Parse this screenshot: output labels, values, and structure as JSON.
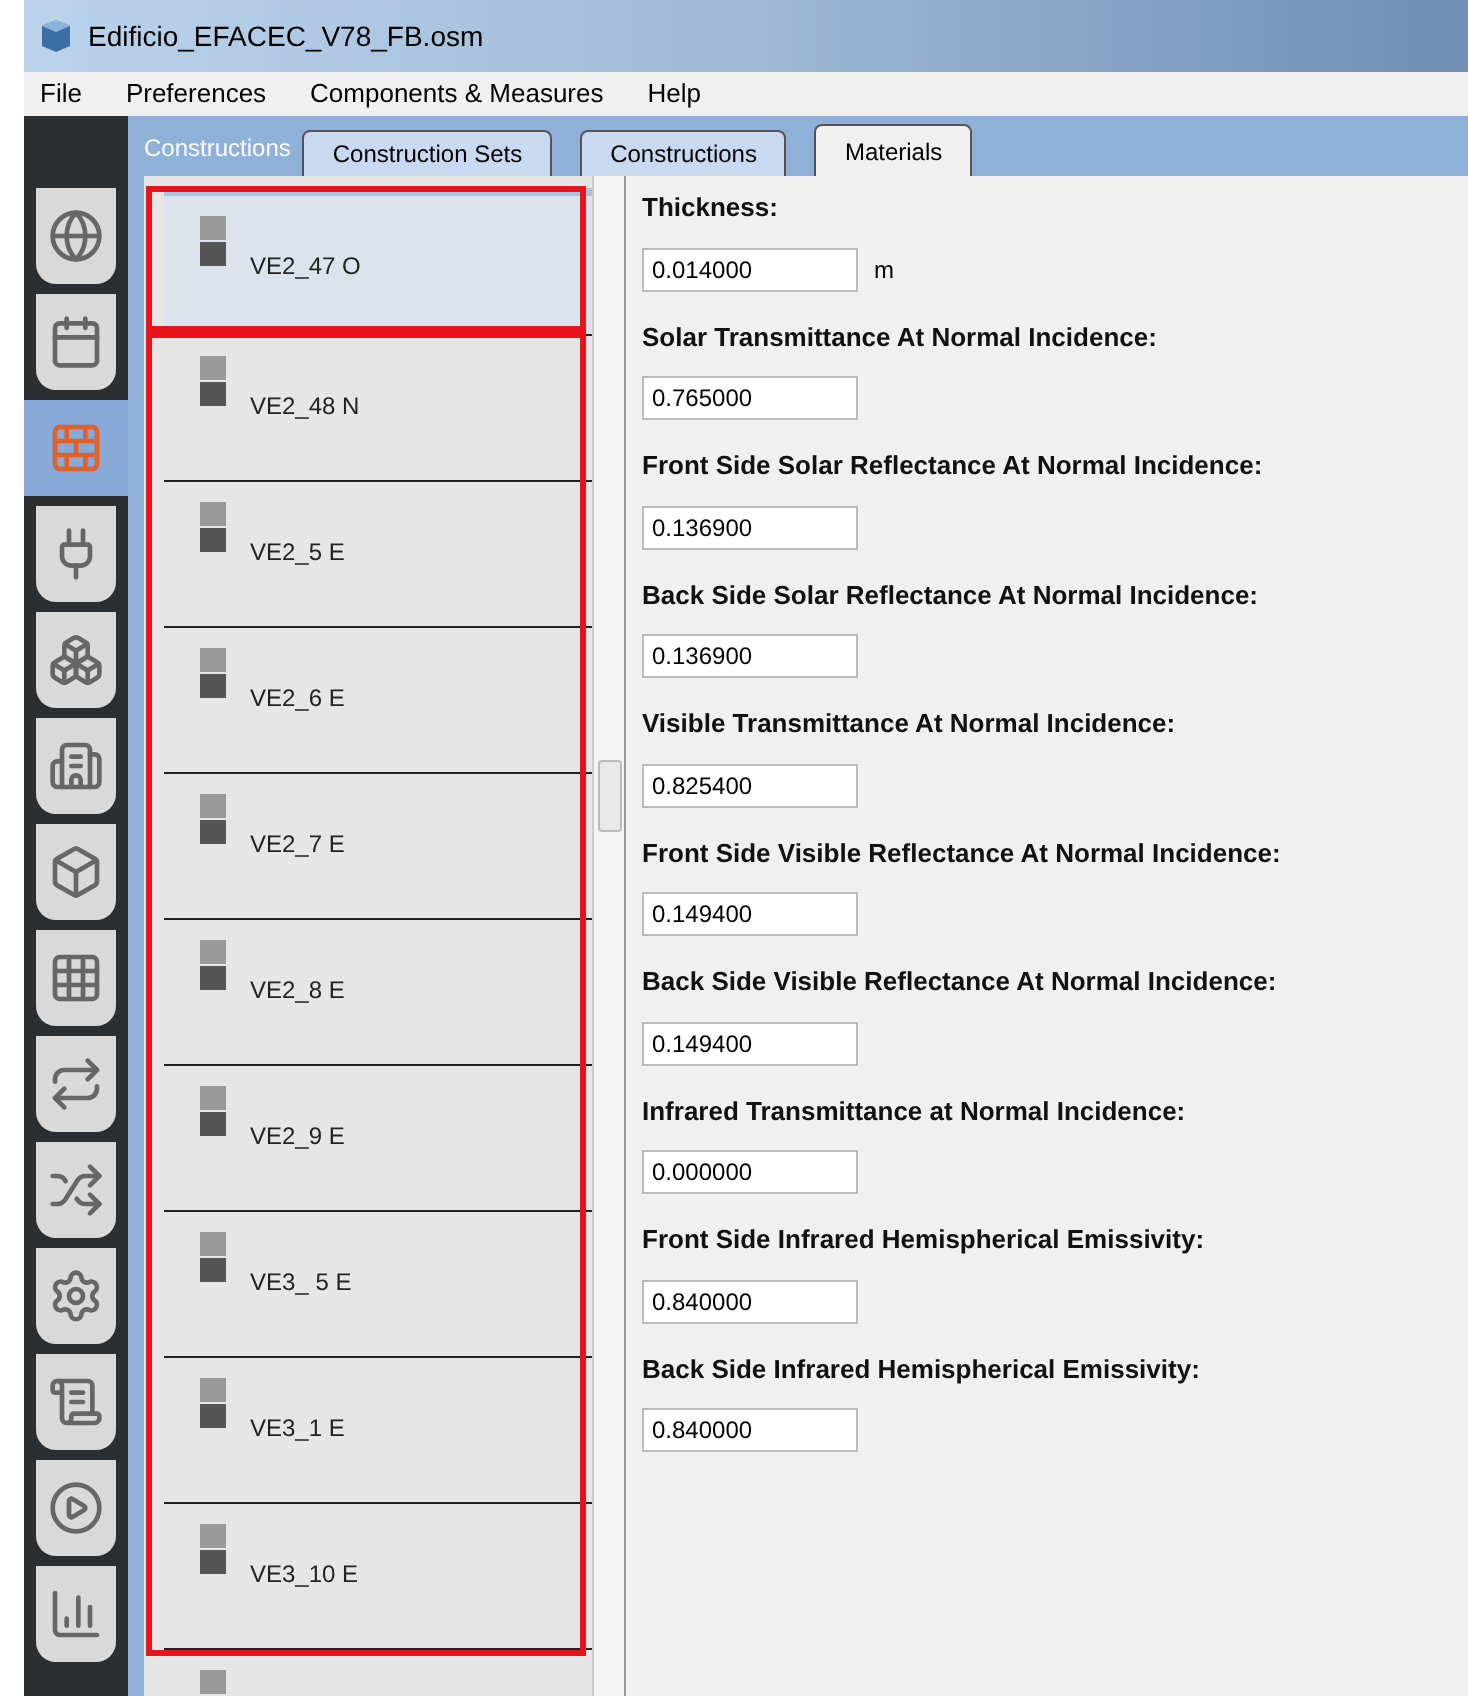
{
  "window": {
    "title": "Edificio_EFACEC_V78_FB.osm"
  },
  "menu": [
    "File",
    "Preferences",
    "Components & Measures",
    "Help"
  ],
  "section_label": "Constructions",
  "tabs": [
    {
      "label": "Construction Sets",
      "selected": false
    },
    {
      "label": "Constructions",
      "selected": false
    },
    {
      "label": "Materials",
      "selected": true
    }
  ],
  "sidebar_icons": [
    {
      "selected": false
    },
    {
      "selected": false
    },
    {
      "selected": true
    },
    {
      "selected": false
    },
    {
      "selected": false
    },
    {
      "selected": false
    },
    {
      "selected": false
    },
    {
      "selected": false
    },
    {
      "selected": false
    },
    {
      "selected": false
    },
    {
      "selected": false
    },
    {
      "selected": false
    },
    {
      "selected": false
    },
    {
      "selected": false
    }
  ],
  "materials": [
    {
      "name": "VE2_47 O",
      "selected": true
    },
    {
      "name": "VE2_48 N",
      "selected": false
    },
    {
      "name": "VE2_5 E",
      "selected": false
    },
    {
      "name": "VE2_6 E",
      "selected": false
    },
    {
      "name": "VE2_7 E",
      "selected": false
    },
    {
      "name": "VE2_8 E",
      "selected": false
    },
    {
      "name": "VE2_9 E",
      "selected": false
    },
    {
      "name": "VE3_ 5 E",
      "selected": false
    },
    {
      "name": "VE3_1 E",
      "selected": false
    },
    {
      "name": "VE3_10 E",
      "selected": false
    }
  ],
  "properties": [
    {
      "label": "Thickness:",
      "value": "0.014000",
      "unit": "m"
    },
    {
      "label": "Solar Transmittance At Normal Incidence:",
      "value": "0.765000"
    },
    {
      "label": "Front Side Solar Reflectance At Normal Incidence:",
      "value": "0.136900"
    },
    {
      "label": "Back Side Solar Reflectance At Normal Incidence:",
      "value": "0.136900"
    },
    {
      "label": "Visible Transmittance At Normal Incidence:",
      "value": "0.825400"
    },
    {
      "label": "Front Side Visible Reflectance At Normal Incidence:",
      "value": "0.149400"
    },
    {
      "label": "Back Side Visible Reflectance At Normal Incidence:",
      "value": "0.149400"
    },
    {
      "label": "Infrared Transmittance at Normal Incidence:",
      "value": "0.000000"
    },
    {
      "label": "Front Side Infrared Hemispherical Emissivity:",
      "value": "0.840000"
    },
    {
      "label": "Back Side Infrared Hemispherical Emissivity:",
      "value": "0.840000"
    }
  ]
}
